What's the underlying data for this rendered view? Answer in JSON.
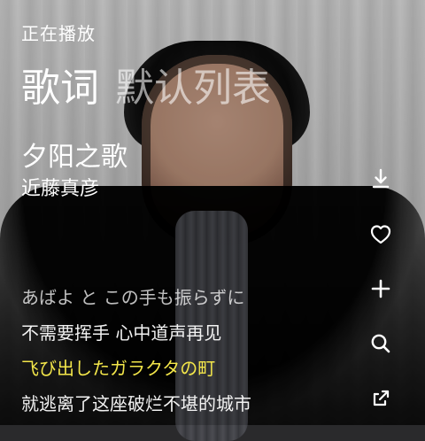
{
  "header": {
    "now_playing": "正在播放"
  },
  "tabs": [
    {
      "label": "歌词",
      "active": true
    },
    {
      "label": "默认列表",
      "active": false
    }
  ],
  "track": {
    "title": "夕阳之歌",
    "artist": "近藤真彦"
  },
  "lyrics": [
    {
      "text": "あばよ と この手も振らずに",
      "state": "dim"
    },
    {
      "text": "不需要挥手 心中道声再见",
      "state": "normal"
    },
    {
      "text": "飞び出したガラクタの町",
      "state": "active"
    },
    {
      "text": "就逃离了这座破烂不堪的城市",
      "state": "normal"
    }
  ],
  "side_actions": [
    {
      "name": "download-icon"
    },
    {
      "name": "heart-icon"
    },
    {
      "name": "plus-icon"
    },
    {
      "name": "search-icon"
    },
    {
      "name": "share-icon"
    }
  ],
  "colors": {
    "active_lyric": "#f3e64a",
    "text": "#ffffff"
  }
}
